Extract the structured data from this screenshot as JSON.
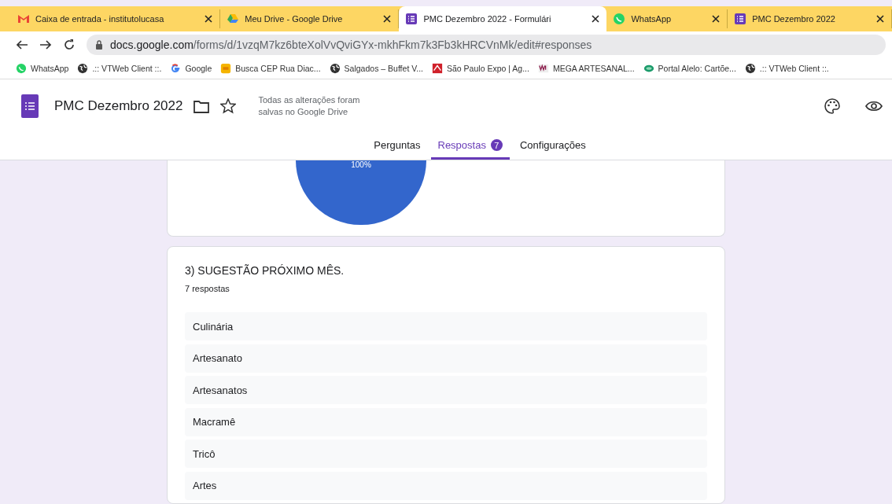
{
  "browser": {
    "tabs": [
      {
        "title": "Caixa de entrada - institutolucasa",
        "selected": false
      },
      {
        "title": "Meu Drive - Google Drive",
        "selected": false
      },
      {
        "title": "PMC Dezembro 2022 - Formulári",
        "selected": true
      },
      {
        "title": "WhatsApp",
        "selected": false
      },
      {
        "title": "PMC Dezembro 2022",
        "selected": false
      }
    ],
    "url_host": "docs.google.com",
    "url_path": "/forms/d/1vzqM7kz6bteXolVvQviGYx-mkhFkm7k3Fb3kHRCVnMk/edit#responses",
    "bookmarks": [
      "WhatsApp",
      ".:: VTWeb Client ::.",
      "Google",
      "Busca CEP Rua Diac...",
      "Salgados – Buffet V...",
      "São Paulo Expo | Ag...",
      "MEGA ARTESANAL...",
      "Portal Alelo: Cartõe...",
      ".:: VTWeb Client ::."
    ]
  },
  "form": {
    "title": "PMC Dezembro 2022",
    "save_status": "Todas as alterações foram salvas no Google Drive",
    "tabs": [
      {
        "label": "Perguntas",
        "selected": false
      },
      {
        "label": "Respostas",
        "selected": true,
        "badge": "7"
      },
      {
        "label": "Configurações",
        "selected": false
      }
    ]
  },
  "pie_label": "100%",
  "question": {
    "title": "3) SUGESTÃO PRÓXIMO MÊS.",
    "count": "7 respostas",
    "answers": [
      "Culinária",
      "Artesanato",
      "Artesanatos",
      "Macramê",
      "Tricô",
      "Artes"
    ]
  }
}
